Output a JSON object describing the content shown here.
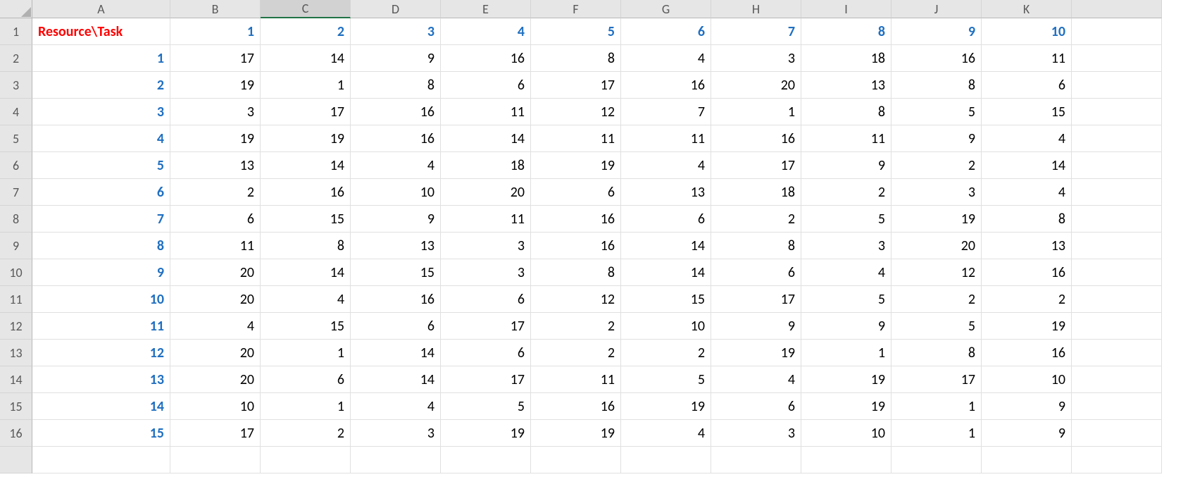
{
  "columns": [
    "A",
    "B",
    "C",
    "D",
    "E",
    "F",
    "G",
    "H",
    "I",
    "J",
    "K",
    ""
  ],
  "selected_column_index": 2,
  "row_numbers": [
    "1",
    "2",
    "3",
    "4",
    "5",
    "6",
    "7",
    "8",
    "9",
    "10",
    "11",
    "12",
    "13",
    "14",
    "15",
    "16",
    ""
  ],
  "header_label": "Resource\\Task",
  "task_headers": [
    "1",
    "2",
    "3",
    "4",
    "5",
    "6",
    "7",
    "8",
    "9",
    "10"
  ],
  "resource_labels": [
    "1",
    "2",
    "3",
    "4",
    "5",
    "6",
    "7",
    "8",
    "9",
    "10",
    "11",
    "12",
    "13",
    "14",
    "15"
  ],
  "data": [
    [
      "17",
      "14",
      "9",
      "16",
      "8",
      "4",
      "3",
      "18",
      "16",
      "11"
    ],
    [
      "19",
      "1",
      "8",
      "6",
      "17",
      "16",
      "20",
      "13",
      "8",
      "6"
    ],
    [
      "3",
      "17",
      "16",
      "11",
      "12",
      "7",
      "1",
      "8",
      "5",
      "15"
    ],
    [
      "19",
      "19",
      "16",
      "14",
      "11",
      "11",
      "16",
      "11",
      "9",
      "4"
    ],
    [
      "13",
      "14",
      "4",
      "18",
      "19",
      "4",
      "17",
      "9",
      "2",
      "14"
    ],
    [
      "2",
      "16",
      "10",
      "20",
      "6",
      "13",
      "18",
      "2",
      "3",
      "4"
    ],
    [
      "6",
      "15",
      "9",
      "11",
      "16",
      "6",
      "2",
      "5",
      "19",
      "8"
    ],
    [
      "11",
      "8",
      "13",
      "3",
      "16",
      "14",
      "8",
      "3",
      "20",
      "13"
    ],
    [
      "20",
      "14",
      "15",
      "3",
      "8",
      "14",
      "6",
      "4",
      "12",
      "16"
    ],
    [
      "20",
      "4",
      "16",
      "6",
      "12",
      "15",
      "17",
      "5",
      "2",
      "2"
    ],
    [
      "4",
      "15",
      "6",
      "17",
      "2",
      "10",
      "9",
      "9",
      "5",
      "19"
    ],
    [
      "20",
      "1",
      "14",
      "6",
      "2",
      "2",
      "19",
      "1",
      "8",
      "16"
    ],
    [
      "20",
      "6",
      "14",
      "17",
      "11",
      "5",
      "4",
      "19",
      "17",
      "10"
    ],
    [
      "10",
      "1",
      "4",
      "5",
      "16",
      "19",
      "6",
      "19",
      "1",
      "9"
    ],
    [
      "17",
      "2",
      "3",
      "19",
      "19",
      "4",
      "3",
      "10",
      "1",
      "9"
    ]
  ]
}
